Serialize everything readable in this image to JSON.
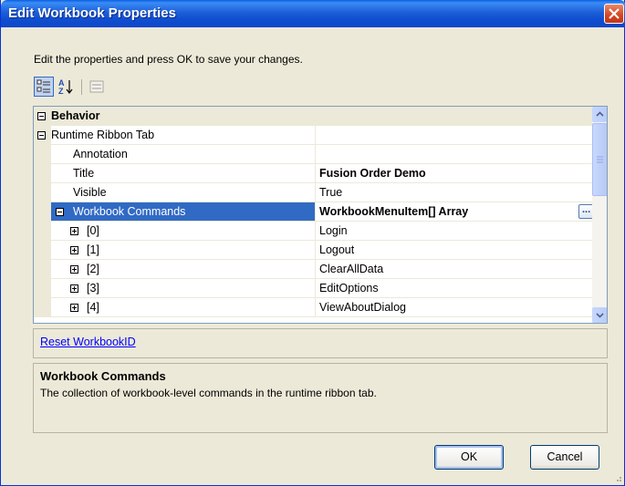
{
  "window": {
    "title": "Edit Workbook Properties"
  },
  "instruction": "Edit the properties and press OK to save your changes.",
  "toolbar": [
    {
      "name": "categorized-icon",
      "state": "active"
    },
    {
      "name": "alphabetical-sort-icon",
      "state": "normal"
    },
    {
      "name": "property-pages-icon",
      "state": "disabled"
    }
  ],
  "grid": {
    "rows": [
      {
        "name": "Behavior",
        "type": "category"
      },
      {
        "name": "Runtime Ribbon Tab",
        "value": ""
      },
      {
        "name": "Annotation",
        "value": ""
      },
      {
        "name": "Title",
        "value": "Fusion Order Demo"
      },
      {
        "name": "Visible",
        "value": "True"
      },
      {
        "name": "Workbook Commands",
        "value": "WorkbookMenuItem[] Array"
      },
      {
        "name": "[0]",
        "value": "Login"
      },
      {
        "name": "[1]",
        "value": "Logout"
      },
      {
        "name": "[2]",
        "value": "ClearAllData"
      },
      {
        "name": "[3]",
        "value": "EditOptions"
      },
      {
        "name": "[4]",
        "value": "ViewAboutDialog"
      }
    ],
    "ellipsis": "..."
  },
  "commands": {
    "reset_link": "Reset WorkbookID"
  },
  "help": {
    "title": "Workbook Commands",
    "description": "The collection of workbook-level commands in the runtime ribbon tab."
  },
  "buttons": {
    "ok": "OK",
    "cancel": "Cancel"
  },
  "colors": {
    "titlebar": "#0A5FE0",
    "selection": "#316AC5",
    "dialog": "#ECE9D8",
    "link": "#0000FF"
  }
}
